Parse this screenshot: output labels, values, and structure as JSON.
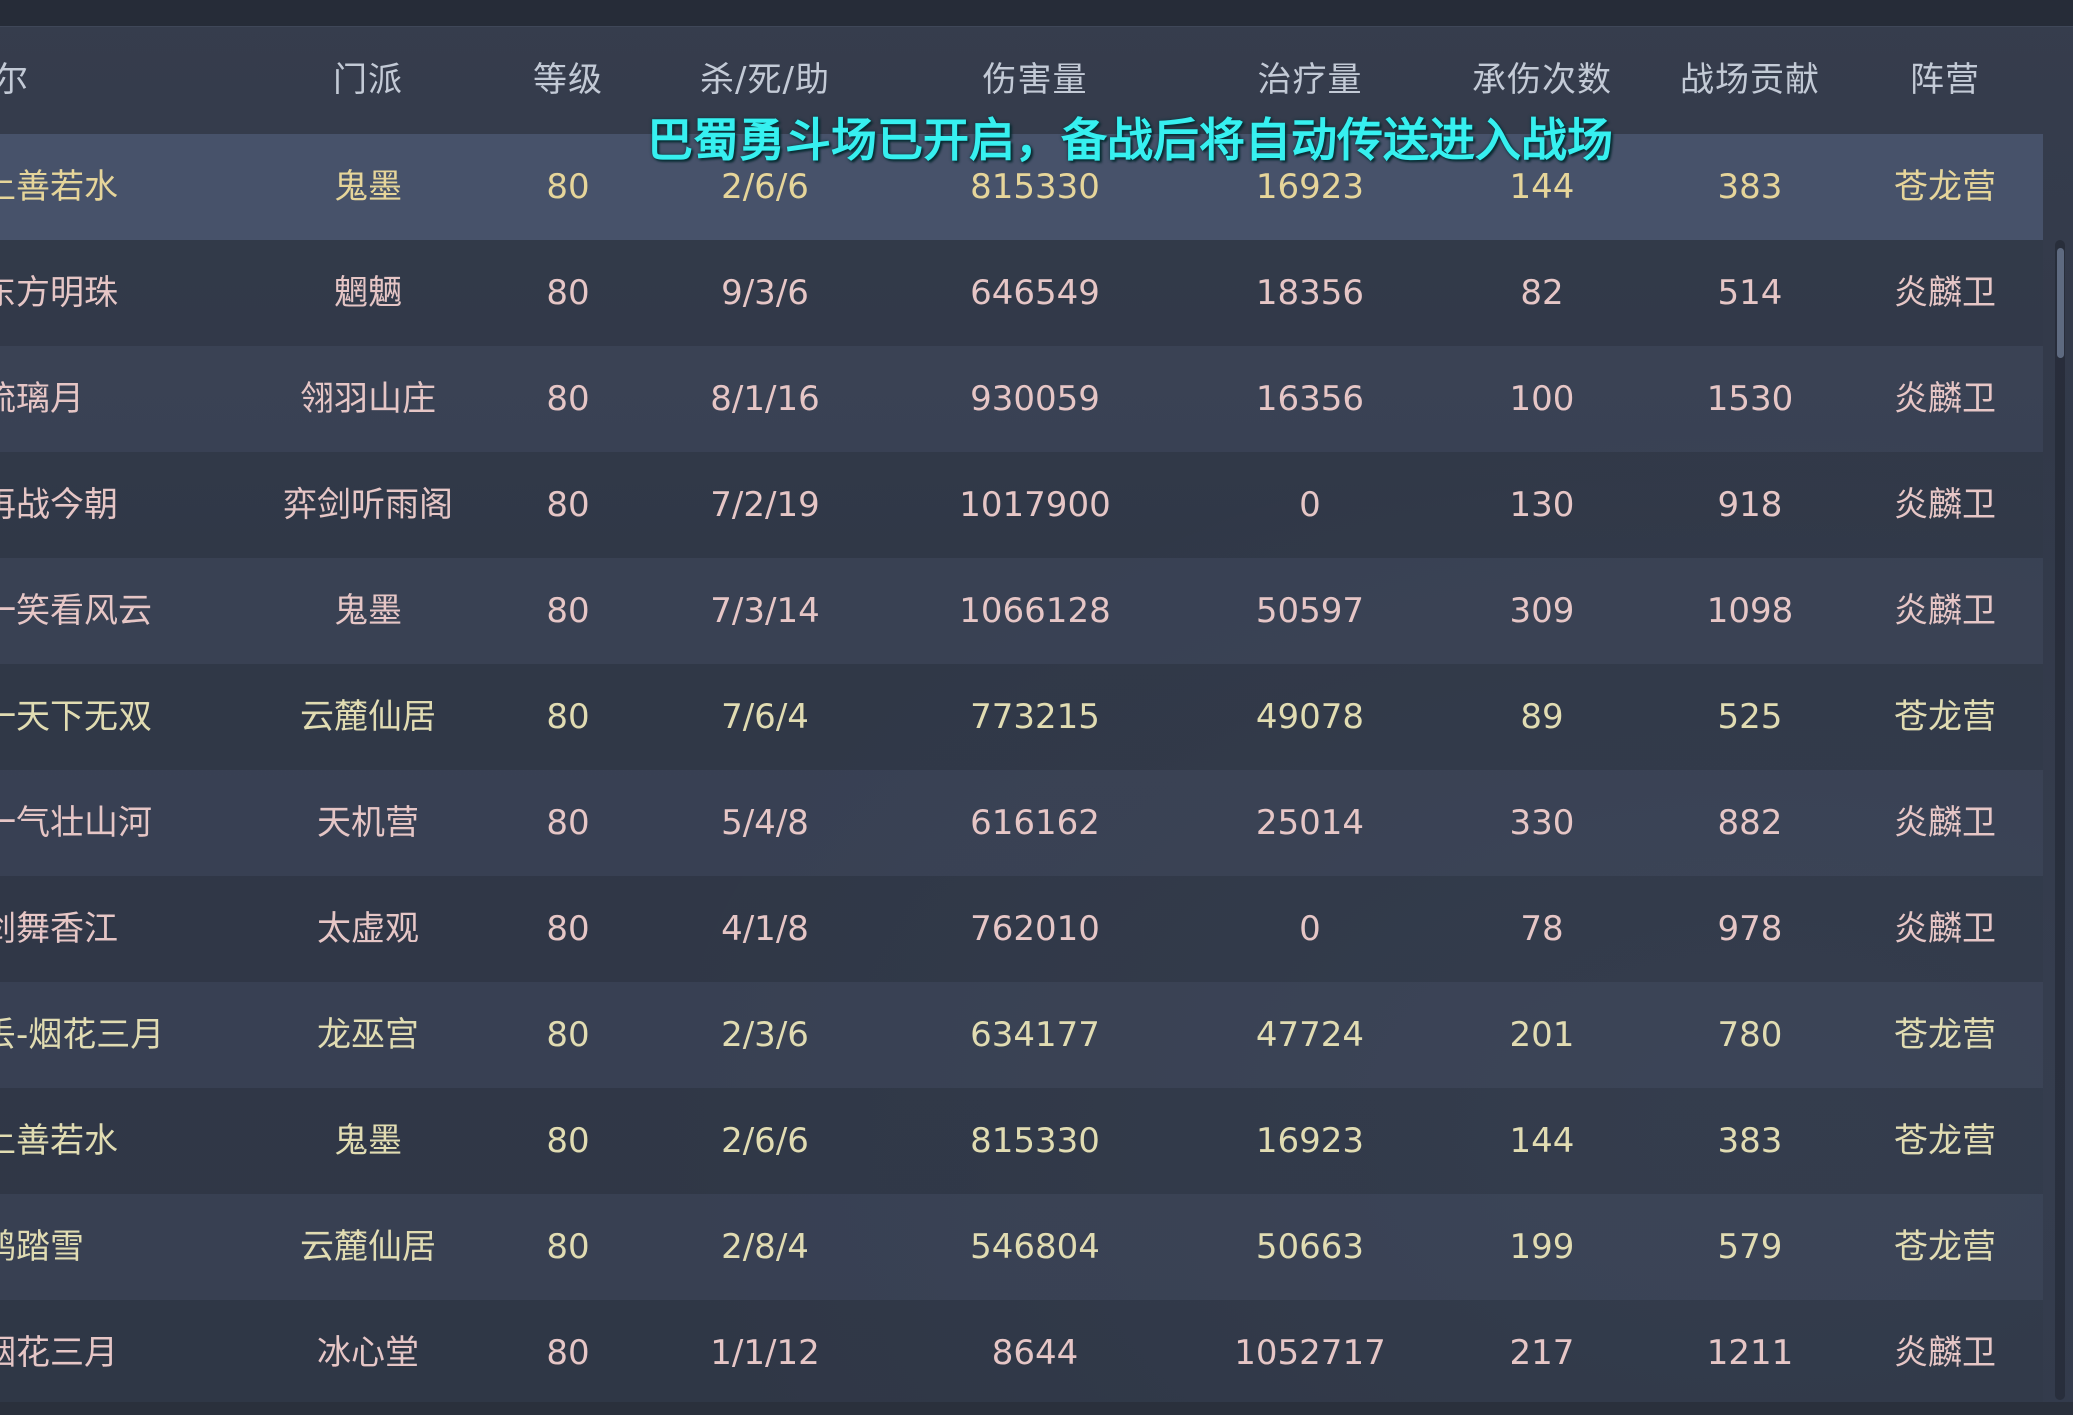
{
  "banner": {
    "text": "巴蜀勇斗场已开启，备战后将自动传送进入战场"
  },
  "header": {
    "name_fragment": "尔",
    "sect": "门派",
    "level": "等级",
    "kda": "杀/死/助",
    "damage": "伤害量",
    "healing": "治疗量",
    "hits_taken": "承伤次数",
    "contribution": "战场贡献",
    "faction": "阵营"
  },
  "colors": {
    "faction_cang": "#e1dcb2",
    "faction_yan": "#e6c6c6",
    "selected_text": "#e6d59a",
    "banner": "#36f0f0"
  },
  "rows": [
    {
      "name": "上善若水",
      "sect": "鬼墨",
      "level": "80",
      "kda": "2/6/6",
      "damage": "815330",
      "healing": "16923",
      "hits_taken": "144",
      "contribution": "383",
      "faction": "苍龙营",
      "side": "cang",
      "selected": true
    },
    {
      "name": "东方明珠",
      "sect": "魍魉",
      "level": "80",
      "kda": "9/3/6",
      "damage": "646549",
      "healing": "18356",
      "hits_taken": "82",
      "contribution": "514",
      "faction": "炎麟卫",
      "side": "yan",
      "selected": false
    },
    {
      "name": "流璃月",
      "sect": "翎羽山庄",
      "level": "80",
      "kda": "8/1/16",
      "damage": "930059",
      "healing": "16356",
      "hits_taken": "100",
      "contribution": "1530",
      "faction": "炎麟卫",
      "side": "yan",
      "selected": false
    },
    {
      "name": "再战今朝",
      "sect": "弈剑听雨阁",
      "level": "80",
      "kda": "7/2/19",
      "damage": "1017900",
      "healing": "0",
      "hits_taken": "130",
      "contribution": "918",
      "faction": "炎麟卫",
      "side": "yan",
      "selected": false
    },
    {
      "name": "一笑看风云",
      "sect": "鬼墨",
      "level": "80",
      "kda": "7/3/14",
      "damage": "1066128",
      "healing": "50597",
      "hits_taken": "309",
      "contribution": "1098",
      "faction": "炎麟卫",
      "side": "yan",
      "selected": false
    },
    {
      "name": "一天下无双",
      "sect": "云麓仙居",
      "level": "80",
      "kda": "7/6/4",
      "damage": "773215",
      "healing": "49078",
      "hits_taken": "89",
      "contribution": "525",
      "faction": "苍龙营",
      "side": "cang",
      "selected": false
    },
    {
      "name": "一气壮山河",
      "sect": "天机营",
      "level": "80",
      "kda": "5/4/8",
      "damage": "616162",
      "healing": "25014",
      "hits_taken": "330",
      "contribution": "882",
      "faction": "炎麟卫",
      "side": "yan",
      "selected": false
    },
    {
      "name": "剑舞香江",
      "sect": "太虚观",
      "level": "80",
      "kda": "4/1/8",
      "damage": "762010",
      "healing": "0",
      "hits_taken": "78",
      "contribution": "978",
      "faction": "炎麟卫",
      "side": "yan",
      "selected": false
    },
    {
      "name": "丢-烟花三月",
      "sect": "龙巫宫",
      "level": "80",
      "kda": "2/3/6",
      "damage": "634177",
      "healing": "47724",
      "hits_taken": "201",
      "contribution": "780",
      "faction": "苍龙营",
      "side": "cang",
      "selected": false
    },
    {
      "name": "上善若水",
      "sect": "鬼墨",
      "level": "80",
      "kda": "2/6/6",
      "damage": "815330",
      "healing": "16923",
      "hits_taken": "144",
      "contribution": "383",
      "faction": "苍龙营",
      "side": "cang",
      "selected": false
    },
    {
      "name": "鸿踏雪",
      "sect": "云麓仙居",
      "level": "80",
      "kda": "2/8/4",
      "damage": "546804",
      "healing": "50663",
      "hits_taken": "199",
      "contribution": "579",
      "faction": "苍龙营",
      "side": "cang",
      "selected": false
    },
    {
      "name": "烟花三月",
      "sect": "冰心堂",
      "level": "80",
      "kda": "1/1/12",
      "damage": "8644",
      "healing": "1052717",
      "hits_taken": "217",
      "contribution": "1211",
      "faction": "炎麟卫",
      "side": "yan",
      "selected": false
    }
  ]
}
